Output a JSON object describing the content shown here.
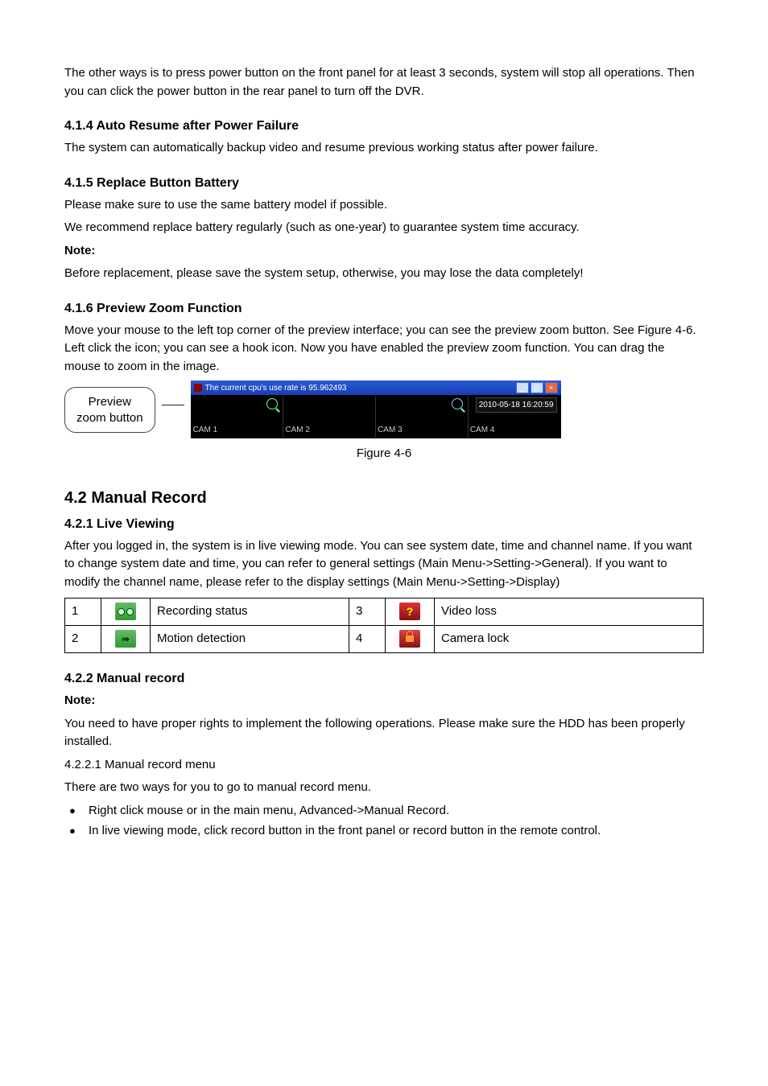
{
  "intro_p1": "The other ways is to press power button on the front panel for at least 3 seconds, system will stop all operations. Then you can click the power button in the rear panel to turn off the DVR.",
  "sec_414": {
    "heading": "4.1.4   Auto Resume after Power Failure",
    "body": "The system can automatically backup video and resume previous working status after power failure."
  },
  "sec_415": {
    "heading": "4.1.5   Replace Button Battery",
    "l1": "Please make sure to use the same battery model if possible.",
    "l2": "We recommend replace battery regularly (such as one-year) to guarantee system time accuracy.",
    "note_label": "Note:",
    "note_body": "Before replacement, please save the system setup, otherwise, you may lose the data completely!"
  },
  "sec_416": {
    "heading": "4.1.6   Preview Zoom Function",
    "body": "Move your mouse to the left top corner of the preview interface; you can see the preview zoom button. See Figure 4-6. Left click the icon; you can see a hook icon. Now you have enabled the preview zoom function. You can drag the mouse to zoom in the image.",
    "callout_l1": "Preview",
    "callout_l2": "zoom button",
    "titlebar_text": "The current cpu's use rate is  95.962493",
    "cam1": "CAM 1",
    "cam2": "CAM 2",
    "cam3": "CAM 3",
    "cam4": "CAM 4",
    "timestamp": "2010-05-18 16:20:59",
    "caption": "Figure 4-6"
  },
  "sec_42": {
    "heading": "4.2   Manual Record"
  },
  "sec_421": {
    "heading": "4.2.1   Live Viewing",
    "body": "After you logged in, the system is in live viewing mode. You can see system date, time and channel name. If you want to change system date and time, you can refer to general settings (Main Menu->Setting->General). If you want to modify the channel name, please refer to the display settings (Main Menu->Setting->Display)"
  },
  "status_table": {
    "r1c1": "1",
    "r1label": "Recording status",
    "r1c4": "3",
    "r1label2": "Video loss",
    "r2c1": "2",
    "r2label": "Motion detection",
    "r2c4": "4",
    "r2label2": "Camera lock"
  },
  "sec_422": {
    "heading": "4.2.2   Manual record",
    "note_label": "Note:",
    "note_body": "You need to have proper rights to implement the following operations. Please make sure the HDD has been properly installed.",
    "sub_heading": "4.2.2.1  Manual record menu",
    "sub_intro": "There are two ways for you to go to manual record menu.",
    "bullet1": "Right click mouse or in the main menu, Advanced->Manual Record.",
    "bullet2": "In live viewing mode, click record button in the front panel or record button in the remote control."
  }
}
